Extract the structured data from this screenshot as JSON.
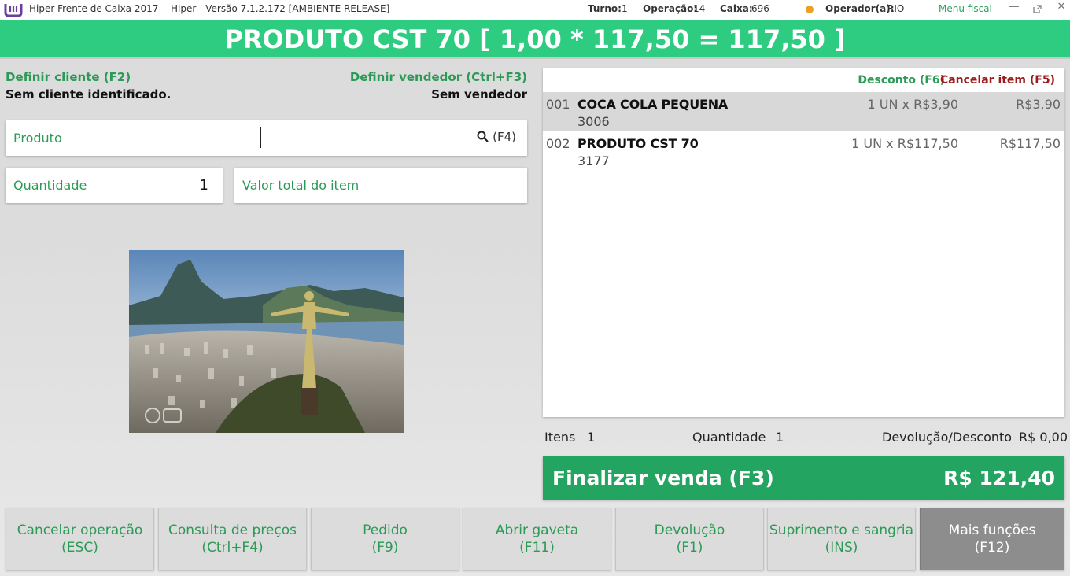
{
  "titlebar": {
    "app_title": "Hiper Frente de Caixa 2017",
    "separator": "-",
    "version": "Hiper - Versão 7.1.2.172 [AMBIENTE RELEASE]",
    "turno_label": "Turno:",
    "turno_value": "1",
    "operacao_label": "Operação:",
    "operacao_value": "14",
    "caixa_label": "Caixa:",
    "caixa_value": "696",
    "operador_label": "Operador(a):",
    "operador_value": "RIO",
    "menu_fiscal": "Menu fiscal",
    "status_color": "#f0a020"
  },
  "banner": {
    "text": "PRODUTO CST 70 [ 1,00 * 117,50 = 117,50 ]",
    "color": "#2ecc80"
  },
  "client": {
    "link": "Definir cliente (F2)",
    "status": "Sem cliente identificado."
  },
  "seller": {
    "link": "Definir vendedor (Ctrl+F3)",
    "status": "Sem vendedor"
  },
  "produto": {
    "label": "Produto",
    "search_shortcut": "(F4)"
  },
  "quantidade": {
    "label": "Quantidade",
    "value": "1"
  },
  "valor_total": {
    "label": "Valor total do item"
  },
  "list": {
    "desconto_link": "Desconto (F6)",
    "cancelar_link": "Cancelar item (F5)",
    "items": [
      {
        "num": "001",
        "name": "COCA COLA PEQUENA",
        "code": "3006",
        "qty": "1 UN x R$3,90",
        "total": "R$3,90"
      },
      {
        "num": "002",
        "name": "PRODUTO CST 70",
        "code": "3177",
        "qty": "1 UN x R$117,50",
        "total": "R$117,50"
      }
    ]
  },
  "summary": {
    "itens_label": "Itens",
    "itens_value": "1",
    "quantidade_label": "Quantidade",
    "quantidade_value": "1",
    "devolucao_label": "Devolução/Desconto",
    "devolucao_value": "R$ 0,00"
  },
  "finalizar": {
    "label": "Finalizar venda (F3)",
    "total": "R$ 121,40"
  },
  "buttons": [
    {
      "label": "Cancelar operação",
      "shortcut": "(ESC)"
    },
    {
      "label": "Consulta de preços",
      "shortcut": "(Ctrl+F4)"
    },
    {
      "label": "Pedido",
      "shortcut": "(F9)"
    },
    {
      "label": "Abrir gaveta",
      "shortcut": "(F11)"
    },
    {
      "label": "Devolução",
      "shortcut": "(F1)"
    },
    {
      "label": "Suprimento e sangria",
      "shortcut": "(INS)"
    },
    {
      "label": "Mais funções",
      "shortcut": "(F12)"
    }
  ],
  "icons": {
    "logo": "hiper-logo-icon",
    "search": "search-icon",
    "minimize": "minimize-icon",
    "popout": "popout-icon",
    "close": "close-icon"
  }
}
